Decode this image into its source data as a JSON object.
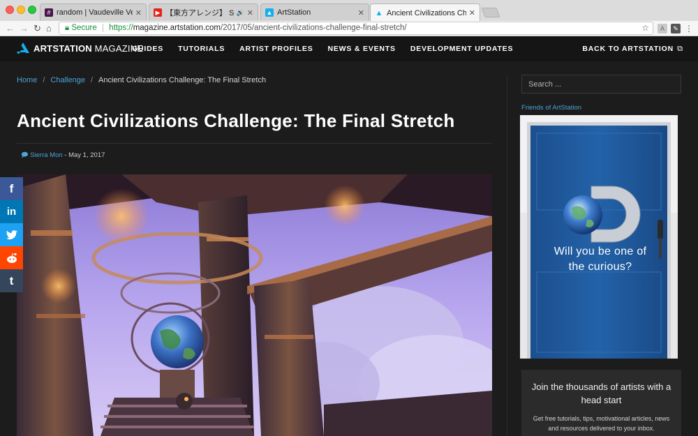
{
  "browser": {
    "tabs": [
      {
        "title": "random | Vaudeville Ventures",
        "favicon": "slack-hash-icon"
      },
      {
        "title": "【東方アレンジ】 Sound of N",
        "favicon": "youtube-icon"
      },
      {
        "title": "ArtStation",
        "favicon": "artstation-icon"
      },
      {
        "title": "Ancient Civilizations Challenge",
        "favicon": "artstation-icon",
        "active": true
      }
    ],
    "address": {
      "secure_label": "Secure",
      "scheme": "https://",
      "host": "magazine.artstation.com",
      "path": "/2017/05/ancient-civilizations-challenge-final-stretch/"
    }
  },
  "site": {
    "logo_bold": "ARTSTATION",
    "logo_rest": " MAGAZINE",
    "nav": [
      "GUIDES",
      "TUTORIALS",
      "ARTIST PROFILES",
      "NEWS & EVENTS",
      "DEVELOPMENT UPDATES"
    ],
    "back_label": "BACK TO ARTSTATION",
    "accent": "#4aa5d9"
  },
  "breadcrumb": {
    "home": "Home",
    "section": "Challenge",
    "current": "Ancient Civilizations Challenge: The Final Stretch"
  },
  "article": {
    "title": "Ancient Civilizations Challenge: The Final Stretch",
    "author": "Sierra Mon",
    "date_text": " - May 1, 2017"
  },
  "share": [
    {
      "name": "facebook-share",
      "glyph": "f",
      "color": "#3b5998"
    },
    {
      "name": "linkedin-share",
      "glyph": "in",
      "color": "#0077b5"
    },
    {
      "name": "twitter-share",
      "glyph": "🐦",
      "color": "#1da1f2"
    },
    {
      "name": "reddit-share",
      "glyph": "r",
      "color": "#ff4500"
    },
    {
      "name": "tumblr-share",
      "glyph": "t",
      "color": "#35465c"
    }
  ],
  "sidebar": {
    "search_placeholder": "Search ...",
    "friends_label": "Friends of ArtStation",
    "ad_caption": "Will you be one of the curious?",
    "join_title": "Join the thousands of artists with a head start",
    "join_sub": "Get free tutorials, tips, motivational articles, news and resources delivered to your inbox."
  }
}
